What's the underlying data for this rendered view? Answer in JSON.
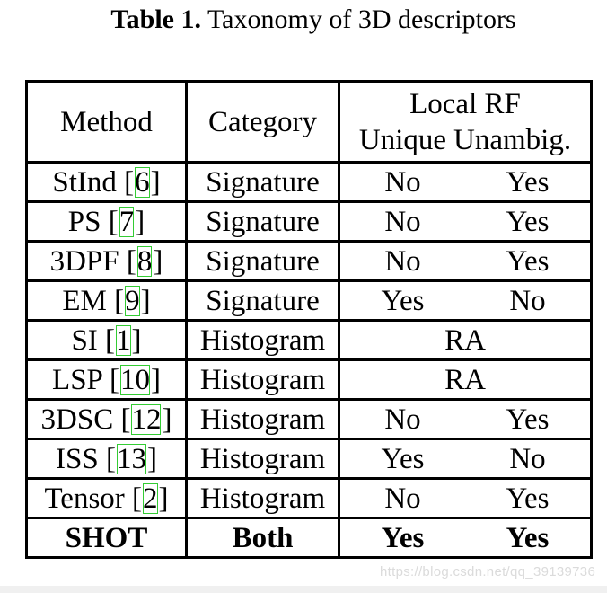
{
  "caption": {
    "label": "Table 1.",
    "text": " Taxonomy of 3D descriptors"
  },
  "table": {
    "headers": {
      "method": "Method",
      "category": "Category",
      "local_rf": "Local RF",
      "unique": "Unique",
      "unambig": "Unambig."
    },
    "rows": [
      {
        "method": "StInd ",
        "ref": "6",
        "category": "Signature",
        "unique": "No",
        "unambig": "Yes"
      },
      {
        "method": "PS ",
        "ref": "7",
        "category": "Signature",
        "unique": "No",
        "unambig": "Yes"
      },
      {
        "method": "3DPF ",
        "ref": "8",
        "category": "Signature",
        "unique": "No",
        "unambig": "Yes"
      },
      {
        "method": "EM ",
        "ref": "9",
        "category": "Signature",
        "unique": "Yes",
        "unambig": "No"
      },
      {
        "method": "SI ",
        "ref": "1",
        "category": "Histogram",
        "merged": "RA"
      },
      {
        "method": "LSP ",
        "ref": "10",
        "category": "Histogram",
        "merged": "RA"
      },
      {
        "method": "3DSC ",
        "ref": "12",
        "category": "Histogram",
        "unique": "No",
        "unambig": "Yes"
      },
      {
        "method": "ISS ",
        "ref": "13",
        "category": "Histogram",
        "unique": "Yes",
        "unambig": "No"
      },
      {
        "method": "Tensor ",
        "ref": "2",
        "category": "Histogram",
        "unique": "No",
        "unambig": "Yes"
      },
      {
        "method": "SHOT",
        "category": "Both",
        "unique": "Yes",
        "unambig": "Yes"
      }
    ]
  },
  "watermark": "https://blog.csdn.net/qq_39139736"
}
